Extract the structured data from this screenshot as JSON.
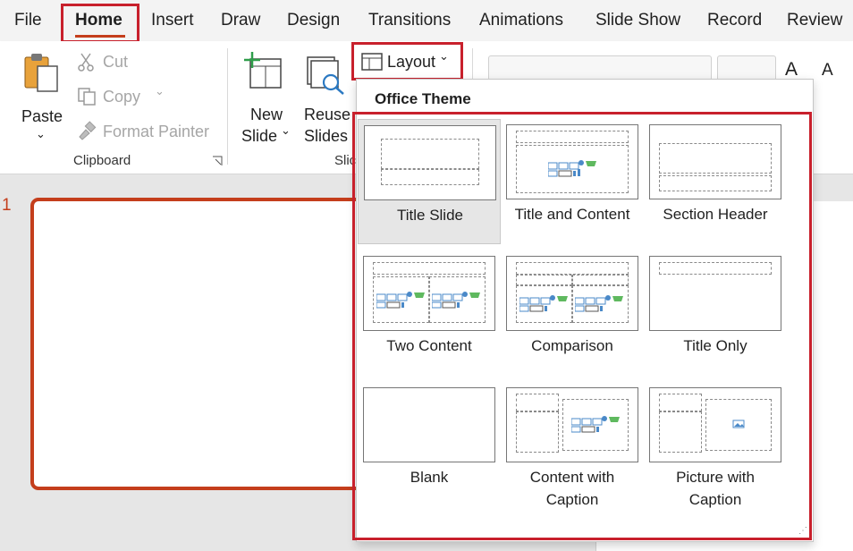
{
  "menu": {
    "tabs": [
      "File",
      "Home",
      "Insert",
      "Draw",
      "Design",
      "Transitions",
      "Animations",
      "Slide Show",
      "Record",
      "Review"
    ],
    "active_tab": "Home"
  },
  "ribbon": {
    "paste_label": "Paste",
    "cut_label": "Cut",
    "copy_label": "Copy",
    "format_painter_label": "Format Painter",
    "clipboard_group_label": "Clipboard",
    "new_slide_line1": "New",
    "new_slide_line2": "Slide",
    "reuse_line1": "Reuse",
    "reuse_line2": "Slides",
    "slides_group_label_partial": "Slic",
    "layout_label": "Layout",
    "font_grow_icon_text": "A",
    "font_shrink_icon_text": "A"
  },
  "slides_pane": {
    "slide_number": "1"
  },
  "layout_menu": {
    "title": "Office Theme",
    "items": [
      {
        "line1": "Title Slide",
        "line2": ""
      },
      {
        "line1": "Title and Content",
        "line2": ""
      },
      {
        "line1": "Section Header",
        "line2": ""
      },
      {
        "line1": "Two Content",
        "line2": ""
      },
      {
        "line1": "Comparison",
        "line2": ""
      },
      {
        "line1": "Title Only",
        "line2": ""
      },
      {
        "line1": "Blank",
        "line2": ""
      },
      {
        "line1": "Content with",
        "line2": "Caption"
      },
      {
        "line1": "Picture with",
        "line2": "Caption"
      }
    ],
    "selected_item": "Title Slide"
  },
  "colors": {
    "accent": "#c43e1c",
    "highlight_box": "#c8202c",
    "selected_item_bg": "#e6e6e6"
  },
  "icons": [
    "paste-icon",
    "cut-icon",
    "copy-icon",
    "format-painter-icon",
    "new-slide-icon",
    "reuse-slides-icon",
    "layout-icon",
    "content-placeholder-icon",
    "picture-placeholder-icon",
    "dialog-launcher-icon"
  ]
}
